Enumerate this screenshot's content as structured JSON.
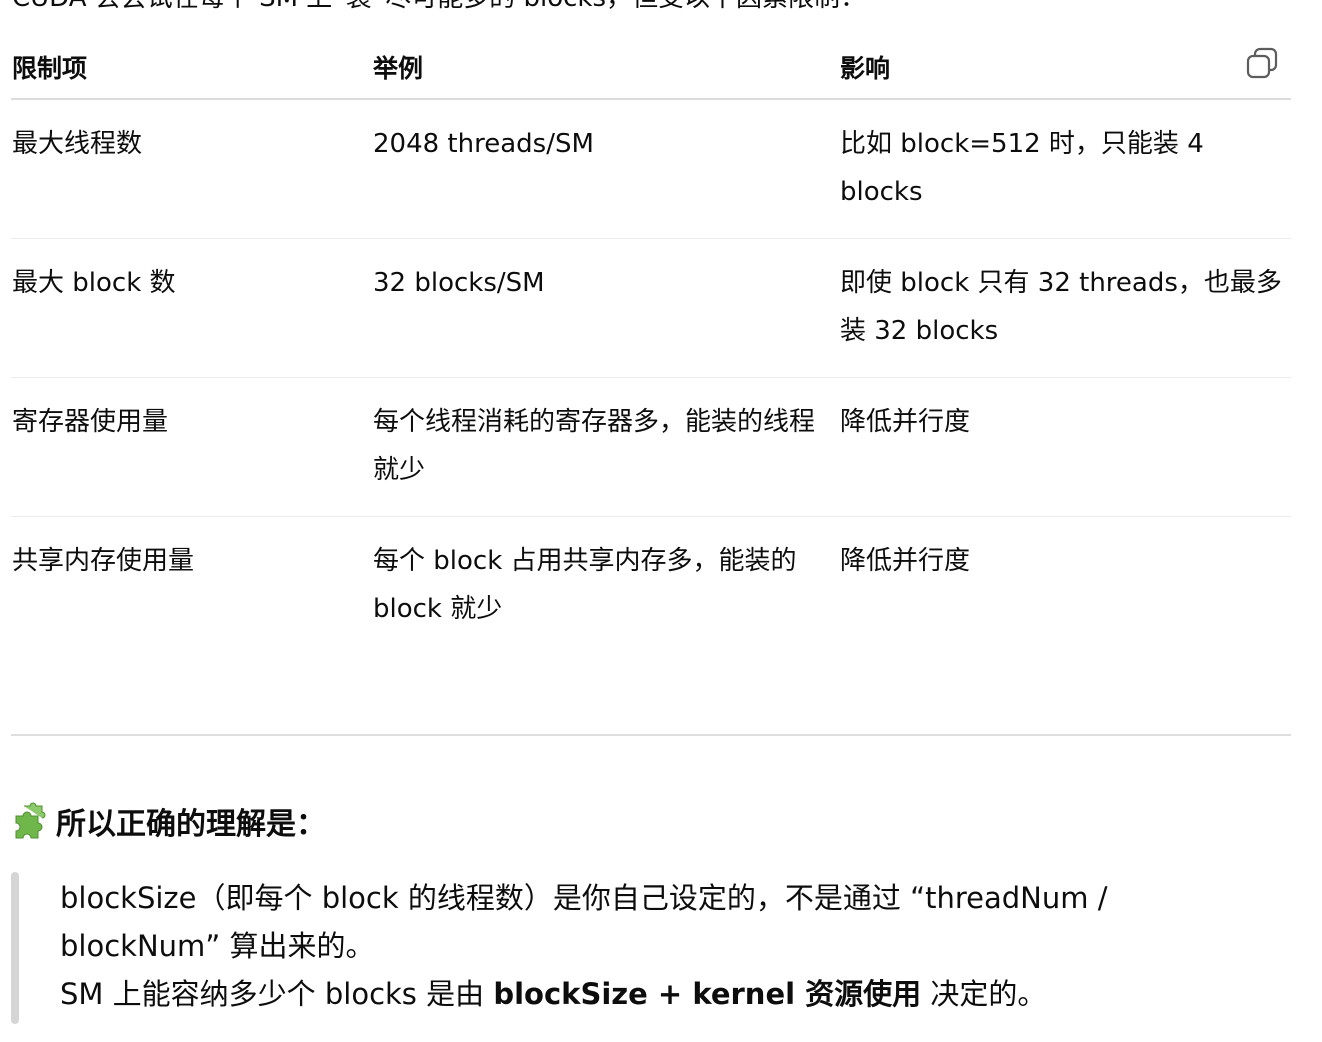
{
  "intro_text": "CUDA 会尝试在每个 SM 上“装”尽可能多的 blocks，但受以下因素限制：",
  "table": {
    "headers": [
      "限制项",
      "举例",
      "影响"
    ],
    "rows": [
      [
        "最大线程数",
        "2048 threads/SM",
        "比如 block=512 时，只能装 4 blocks"
      ],
      [
        "最大 block 数",
        "32 blocks/SM",
        "即使 block 只有 32 threads，也最多装 32 blocks"
      ],
      [
        "寄存器使用量",
        "每个线程消耗的寄存器多，能装的线程就少",
        "降低并行度"
      ],
      [
        "共享内存使用量",
        "每个 block 占用共享内存多，能装的 block 就少",
        "降低并行度"
      ]
    ],
    "copy_icon": "copy-icon"
  },
  "section": {
    "icon": "puzzle-piece-icon",
    "heading": "所以正确的理解是："
  },
  "quote": {
    "line1": "blockSize（即每个 block 的线程数）是你自己设定的，不是通过 “threadNum /",
    "line2": "blockNum” 算出来的。",
    "line3_pre": "SM 上能容纳多少个 blocks 是由 ",
    "line3_bold": "blockSize + kernel 资源使用",
    "line3_post": " 决定的。"
  },
  "colors": {
    "text": "#0d0d0d",
    "border": "#dcdcdc",
    "quote_bar": "#d5d5d5",
    "puzzle_green": "#6fb74a"
  }
}
